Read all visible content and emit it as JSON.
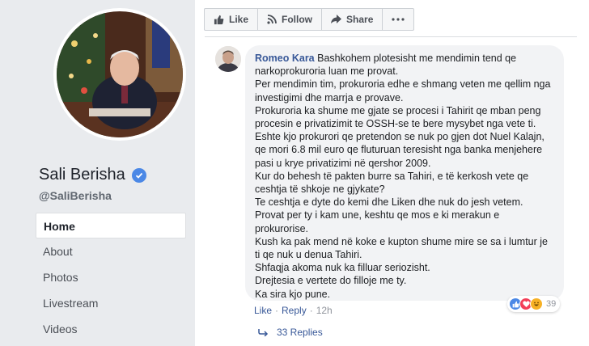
{
  "profile": {
    "name": "Sali Berisha",
    "handle": "@SaliBerisha"
  },
  "nav": {
    "items": [
      {
        "label": "Home"
      },
      {
        "label": "About"
      },
      {
        "label": "Photos"
      },
      {
        "label": "Livestream"
      },
      {
        "label": "Videos"
      }
    ]
  },
  "actions": {
    "like_label": "Like",
    "follow_label": "Follow",
    "share_label": "Share"
  },
  "comment": {
    "author": "Romeo Kara",
    "paragraphs": [
      "Bashkohem plotesisht me mendimin tend qe narkoprokuroria luan me provat.",
      "Per mendimin tim, prokuroria edhe e shmang veten me qellim nga investigimi dhe marrja e provave.",
      "Prokuroria ka shume me gjate se procesi i Tahirit qe mban peng procesin e privatizimit te OSSH-se te bere mysybet nga vete ti.",
      "Eshte kjo prokurori qe pretendon se nuk po gjen dot Nuel Kalajn, qe mori 6.8 mil euro qe fluturuan teresisht nga banka menjehere pasi u kryе privatizimi në qershor 2009.",
      "Kur do behesh të pakten burre sa Tahiri, e të kerkosh vete qe ceshtja të shkoje ne gjykate?",
      "Te ceshtja e dyte do kemi dhe Liken dhe nuk do jesh vetem.",
      "Provat per ty i kam une, keshtu qe mos e ki merakun e prokurorise.",
      "Kush ka pak mend në koke e kupton shume mire se sa i lumtur je ti qe nuk u denua Tahiri.",
      "Shfaqja akoma nuk ka filluar seriozisht.",
      "Drejtesia e vertete do filloje me ty.",
      "Ka sira kjo pune."
    ],
    "like_label": "Like",
    "reply_label": "Reply",
    "time": "12h",
    "reaction_count": "39",
    "replies_label": "33 Replies"
  },
  "colors": {
    "link": "#385898",
    "like_blue": "#4b88e6",
    "love_red": "#f33e58",
    "haha_yellow": "#f7b125"
  },
  "icons": {
    "like": "thumbs-up-icon",
    "follow": "rss-icon",
    "share": "share-arrow-icon",
    "more": "ellipsis-icon",
    "verified": "verified-check-icon",
    "reply": "reply-arrow-icon"
  }
}
